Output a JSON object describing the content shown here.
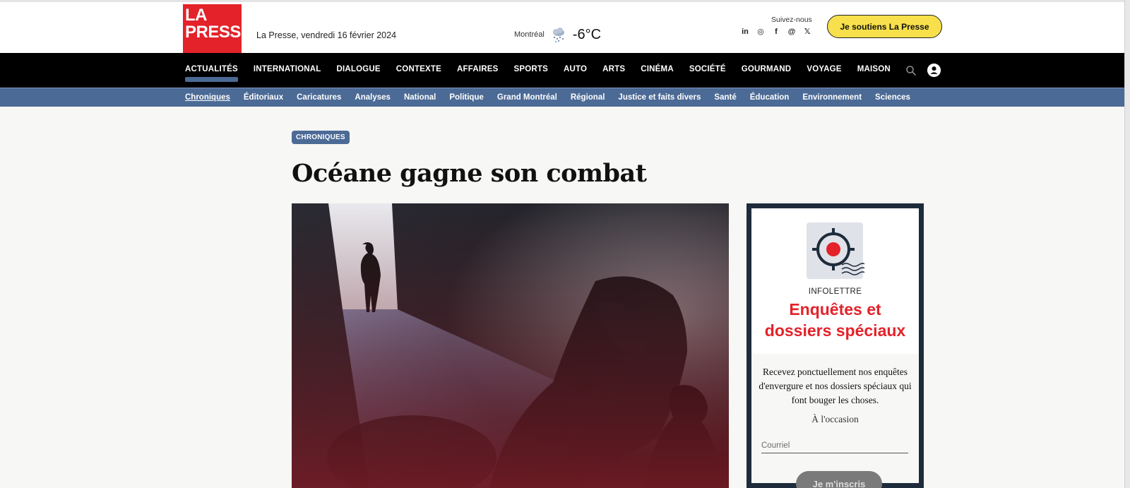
{
  "header": {
    "logo_line1": "LA",
    "logo_line2": "PRESSE",
    "date": "La Presse, vendredi 16 février 2024",
    "weather": {
      "city": "Montréal",
      "temp": "-6°C",
      "icon": "snow-cloud-icon"
    },
    "follow_label": "Suivez-nous",
    "socials": [
      {
        "name": "linkedin-icon",
        "glyph": "in"
      },
      {
        "name": "instagram-icon",
        "glyph": "◎"
      },
      {
        "name": "facebook-icon",
        "glyph": "f"
      },
      {
        "name": "threads-icon",
        "glyph": "@"
      },
      {
        "name": "x-icon",
        "glyph": "𝕏"
      }
    ],
    "support_label": "Je soutiens La Presse"
  },
  "main_nav": {
    "items": [
      "ACTUALITÉS",
      "INTERNATIONAL",
      "DIALOGUE",
      "CONTEXTE",
      "AFFAIRES",
      "SPORTS",
      "AUTO",
      "ARTS",
      "CINÉMA",
      "SOCIÉTÉ",
      "GOURMAND",
      "VOYAGE",
      "MAISON"
    ],
    "active": "ACTUALITÉS"
  },
  "sub_nav": {
    "items": [
      "Chroniques",
      "Éditoriaux",
      "Caricatures",
      "Analyses",
      "National",
      "Politique",
      "Grand Montréal",
      "Régional",
      "Justice et faits divers",
      "Santé",
      "Éducation",
      "Environnement",
      "Sciences"
    ],
    "active": "Chroniques"
  },
  "article": {
    "badge": "CHRONIQUES",
    "headline": "Océane gagne son combat"
  },
  "newsletter": {
    "kicker": "INFOLETTRE",
    "title_line1": "Enquêtes et",
    "title_line2": "dossiers spéciaux",
    "description": "Recevez ponctuellement nos enquêtes d'envergure et nos dossiers spéciaux qui font bouger les choses.",
    "frequency": "À l'occasion",
    "email_placeholder": "Courriel",
    "button_label": "Je m'inscris"
  },
  "colors": {
    "brand_red": "#e3222a",
    "nav_black": "#000000",
    "subnav_blue": "#4b6a95",
    "support_yellow": "#f7e04b"
  }
}
